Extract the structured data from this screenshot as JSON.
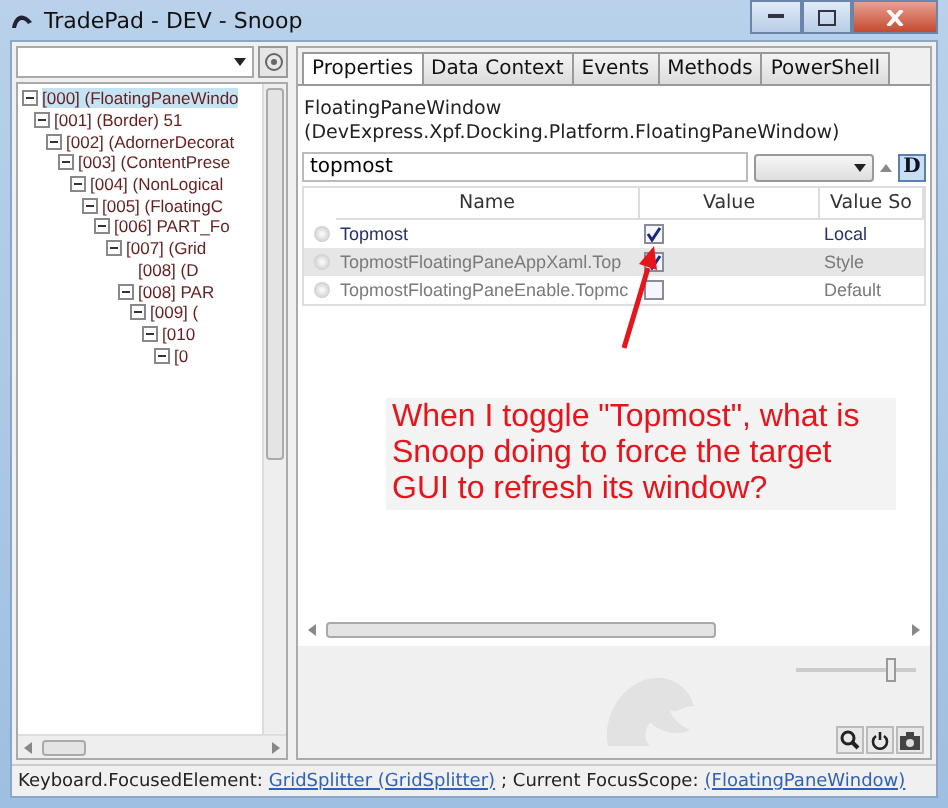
{
  "window": {
    "title": "TradePad - DEV - Snoop"
  },
  "tree": {
    "items": [
      {
        "label": "[000]  (FloatingPaneWindo",
        "selected": true,
        "expanded": true,
        "children": [
          {
            "label": "[001]  (Border) 51",
            "selected": false,
            "expanded": true,
            "children": [
              {
                "label": "[002]  (AdornerDecorat",
                "selected": false,
                "expanded": true,
                "children": [
                  {
                    "label": "[003]  (ContentPrese",
                    "selected": false,
                    "expanded": true,
                    "children": [
                      {
                        "label": "[004]  (NonLogical",
                        "selected": false,
                        "expanded": true,
                        "children": [
                          {
                            "label": "[005]  (FloatingC",
                            "selected": false,
                            "expanded": true,
                            "children": [
                              {
                                "label": "[006] PART_Fo",
                                "selected": false,
                                "expanded": true,
                                "children": [
                                  {
                                    "label": "[007]  (Grid",
                                    "selected": false,
                                    "expanded": true,
                                    "children": [
                                      {
                                        "label": "[008]  (D",
                                        "selected": false,
                                        "expanded": false
                                      },
                                      {
                                        "label": "[008] PAR",
                                        "selected": false,
                                        "expanded": true,
                                        "children": [
                                          {
                                            "label": "[009]  (",
                                            "selected": false,
                                            "expanded": true,
                                            "children": [
                                              {
                                                "label": "[010",
                                                "selected": false,
                                                "expanded": true,
                                                "children": [
                                                  {
                                                    "label": "[0",
                                                    "selected": false,
                                                    "expanded": true
                                                  }
                                                ]
                                              }
                                            ]
                                          }
                                        ]
                                      }
                                    ]
                                  }
                                ]
                              }
                            ]
                          }
                        ]
                      }
                    ]
                  }
                ]
              }
            ]
          }
        ]
      }
    ]
  },
  "tabs": [
    {
      "label": "Properties",
      "selected": true
    },
    {
      "label": "Data Context",
      "selected": false
    },
    {
      "label": "Events",
      "selected": false
    },
    {
      "label": "Methods",
      "selected": false
    },
    {
      "label": "PowerShell",
      "selected": false
    }
  ],
  "header": {
    "type_name": "FloatingPaneWindow",
    "full_name": "(DevExpress.Xpf.Docking.Platform.FloatingPaneWindow)"
  },
  "filter": {
    "value": "topmost",
    "d_button": "D"
  },
  "grid": {
    "columns": [
      "Name",
      "Value",
      "Value So"
    ],
    "rows": [
      {
        "name": "Topmost",
        "checked": true,
        "source": "Local",
        "selected": false,
        "dimmed": false
      },
      {
        "name": "TopmostFloatingPaneAppXaml.Top",
        "checked": true,
        "source": "Style",
        "selected": true,
        "dimmed": true
      },
      {
        "name": "TopmostFloatingPaneEnable.Topmc",
        "checked": false,
        "source": "Default",
        "selected": false,
        "dimmed": true
      }
    ]
  },
  "annotation": {
    "text": "When I toggle \"Topmost\", what is Snoop doing to force the target GUI to refresh its window?"
  },
  "zoom": {
    "level": 0.78
  },
  "status_bar": {
    "parts": [
      {
        "kind": "text",
        "text": "Keyboard.FocusedElement:"
      },
      {
        "kind": "link",
        "text": "GridSplitter (GridSplitter)"
      },
      {
        "kind": "text",
        "text": "; Current FocusScope:"
      },
      {
        "kind": "link",
        "text": "(FloatingPaneWindow)"
      }
    ]
  }
}
